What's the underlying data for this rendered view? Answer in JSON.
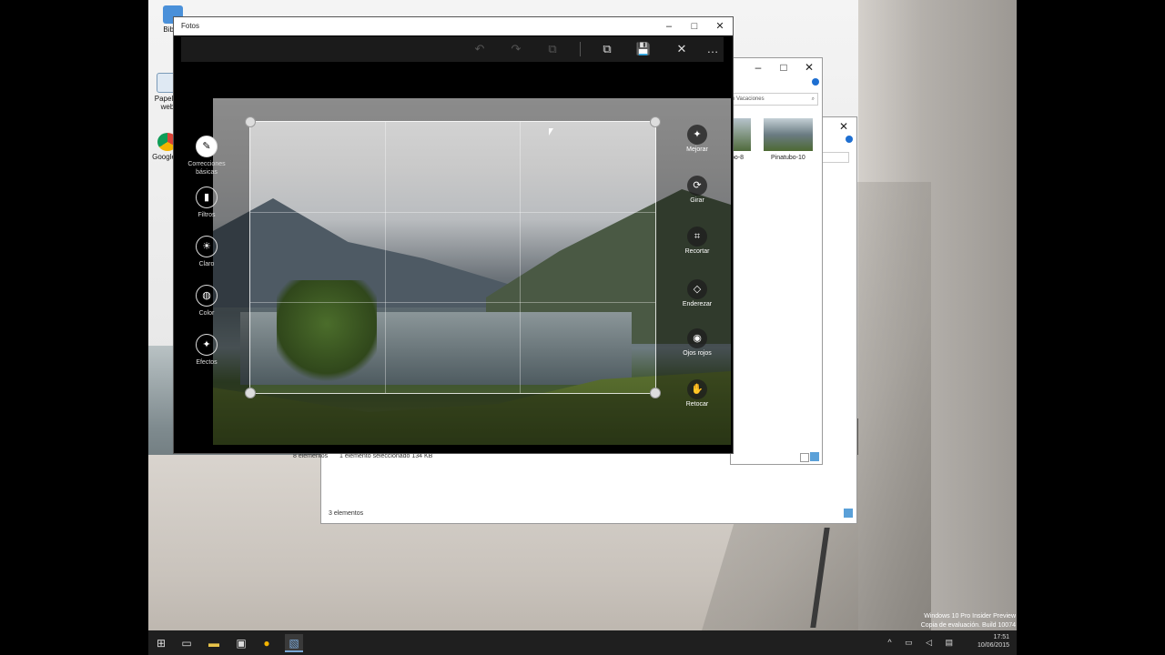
{
  "desktop_icons": [
    {
      "label": "Bibl…",
      "icon": "computer-icon"
    },
    {
      "label": "Papel… web",
      "icon": "recycle-bin-icon"
    },
    {
      "label": "Google…",
      "icon": "chrome-icon"
    }
  ],
  "photos": {
    "title": "Fotos",
    "window_buttons": {
      "minimize": "–",
      "maximize": "□",
      "close": "✕"
    },
    "commands": {
      "undo": "↶",
      "redo": "↷",
      "compare": "⧉",
      "save_copy": "⧉",
      "save": "💾",
      "cancel": "✕",
      "more": "…"
    },
    "left_tools": [
      {
        "label": "Correcciones básicas",
        "glyph": "✎",
        "active": true
      },
      {
        "label": "Filtros",
        "glyph": "▮",
        "active": false
      },
      {
        "label": "Claro",
        "glyph": "☀",
        "active": false
      },
      {
        "label": "Color",
        "glyph": "◍",
        "active": false
      },
      {
        "label": "Efectos",
        "glyph": "✦",
        "active": false
      }
    ],
    "right_tools": [
      {
        "label": "Mejorar",
        "glyph": "✦"
      },
      {
        "label": "Girar",
        "glyph": "⟳"
      },
      {
        "label": "Recortar",
        "glyph": "⌗"
      },
      {
        "label": "Enderezar",
        "glyph": "◇"
      },
      {
        "label": "Ojos rojos",
        "glyph": "◉"
      },
      {
        "label": "Retocar",
        "glyph": "✋"
      }
    ]
  },
  "explorer_front": {
    "search_placeholder": "n Vacaciones",
    "thumbnails": [
      {
        "label": "bo-8"
      },
      {
        "label": "Pinatubo-10"
      }
    ],
    "status_count": "8 elementos",
    "status_selection": "1 elemento seleccionado  134 KB"
  },
  "explorer_back": {
    "status_count": "3 elementos"
  },
  "taskbar": {
    "time": "17:51",
    "date": "10/06/2015"
  },
  "watermark": {
    "line1": "Windows 10 Pro Insider Preview",
    "line2": "Copia de evaluación. Build 10074"
  }
}
